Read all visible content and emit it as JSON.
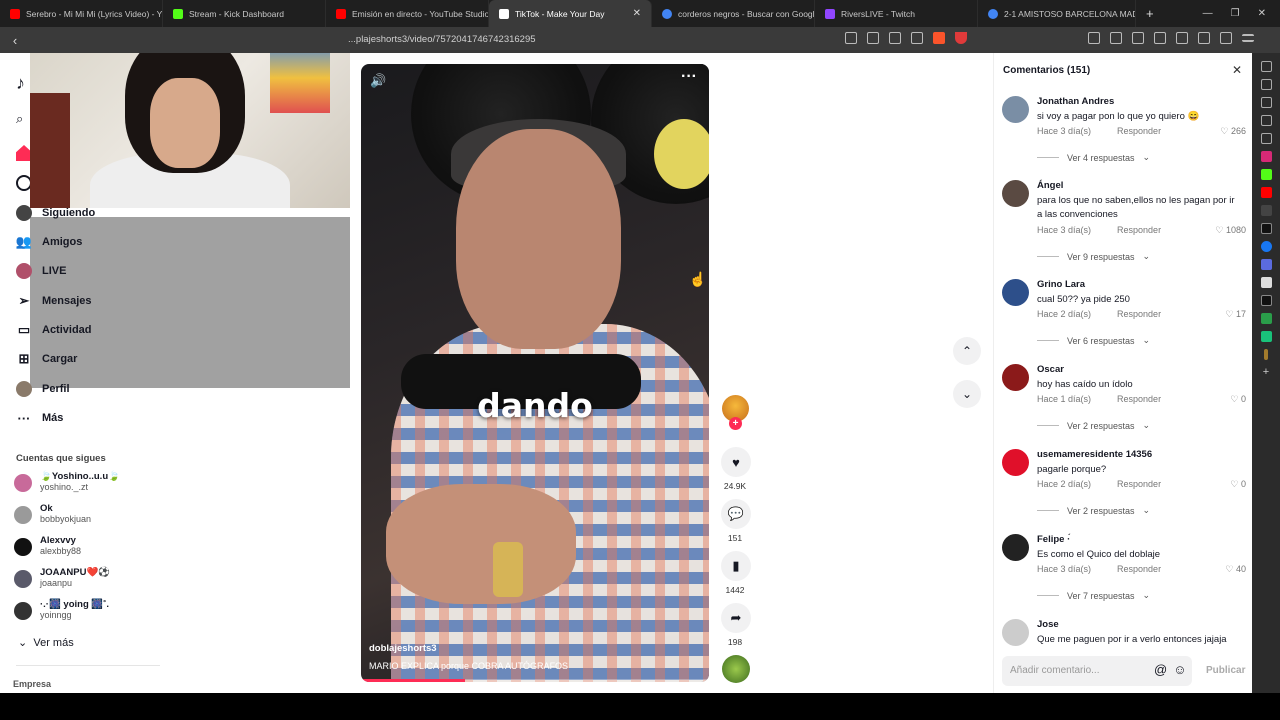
{
  "browser": {
    "tabs": [
      {
        "title": "Serebro - Mi Mi Mi (Lyrics Video) - Yo",
        "color": "#ff0000"
      },
      {
        "title": "Stream - Kick Dashboard",
        "color": "#53fc18"
      },
      {
        "title": "Emisión en directo - YouTube Studio",
        "color": "#ff0000"
      },
      {
        "title": "TikTok - Make Your Day",
        "color": "#ffffff"
      },
      {
        "title": "corderos negros - Buscar con Google",
        "color": "#4285f4"
      },
      {
        "title": "RiversLIVE - Twitch",
        "color": "#9146ff"
      },
      {
        "title": "2-1 AMISTOSO BARCELONA MADRI",
        "color": "#4285f4"
      }
    ],
    "url": "...plajeshorts3/video/7572041746742316295"
  },
  "sidebar": {
    "logo": "♪",
    "nav": [
      {
        "label": "Siguiendo",
        "icon": "avatar-icon"
      },
      {
        "label": "Amigos",
        "icon": "friends-icon"
      },
      {
        "label": "LIVE",
        "icon": "live-icon"
      },
      {
        "label": "Mensajes",
        "icon": "send-icon"
      },
      {
        "label": "Actividad",
        "icon": "activity-icon",
        "badge": "1"
      },
      {
        "label": "Cargar",
        "icon": "upload-icon"
      },
      {
        "label": "Perfil",
        "icon": "profile-icon"
      },
      {
        "label": "Más",
        "icon": "more-icon"
      }
    ],
    "following_title": "Cuentas que sigues",
    "accounts": [
      {
        "name": "🍃Yoshino..u.u🍃",
        "handle": "yoshino._.zt"
      },
      {
        "name": "Ok",
        "handle": "bobbyokjuan"
      },
      {
        "name": "Alexvvy",
        "handle": "alexbby88"
      },
      {
        "name": "JOAANPU❤️⚽",
        "handle": "joaanpu"
      },
      {
        "name": "·.·🎆 yoing 🎆˚.",
        "handle": "yoinngg"
      }
    ],
    "see_more": "Ver más",
    "footer": "Empresa"
  },
  "video": {
    "caption_word": "dando",
    "author": "doblajeshorts3",
    "description": "MARIO EXPLICA porque COBRA AUTÓGRAFOS",
    "progress": 0.3
  },
  "actions": {
    "likes": "24.9K",
    "comments": "151",
    "saves": "1442",
    "shares": "198"
  },
  "comments_panel": {
    "title": "Comentarios (151)",
    "input_placeholder": "Añadir comentario...",
    "post_label": "Publicar",
    "reply_label": "Responder",
    "items": [
      {
        "name": "Jonathan Andres",
        "text": "si voy a pagar pon lo que yo quiero 😄",
        "time": "Hace 3 día(s)",
        "likes": "266",
        "replies": "Ver 4 respuestas",
        "avatar_color": "#7a8ea5"
      },
      {
        "name": "Ángel",
        "text": "para los que no saben,ellos no les pagan por ir a las convenciones",
        "time": "Hace 3 día(s)",
        "likes": "1080",
        "replies": "Ver 9 respuestas",
        "avatar_color": "#5a4a42"
      },
      {
        "name": "Grino Lara",
        "text": "cual 50?? ya pide 250",
        "time": "Hace 2 día(s)",
        "likes": "17",
        "replies": "Ver 6 respuestas",
        "avatar_color": "#2d4f8a"
      },
      {
        "name": "Oscar",
        "text": "hoy has caído un ídolo",
        "time": "Hace 1 día(s)",
        "likes": "0",
        "replies": "Ver 2 respuestas",
        "avatar_color": "#8b1a1a"
      },
      {
        "name": "usemameresidente 14356",
        "text": "pagarle porque?",
        "time": "Hace 2 día(s)",
        "likes": "0",
        "replies": "Ver 2 respuestas",
        "avatar_color": "#e0102a"
      },
      {
        "name": "Felipe ·́",
        "text": "Es como el Quico del doblaje",
        "time": "Hace 3 día(s)",
        "likes": "40",
        "replies": "Ver 7 respuestas",
        "avatar_color": "#222222"
      },
      {
        "name": "Jose",
        "text": "Que me paguen por ir a verlo entonces jajaja",
        "time": "",
        "likes": "",
        "replies": "",
        "avatar_color": "#cccccc"
      }
    ]
  }
}
